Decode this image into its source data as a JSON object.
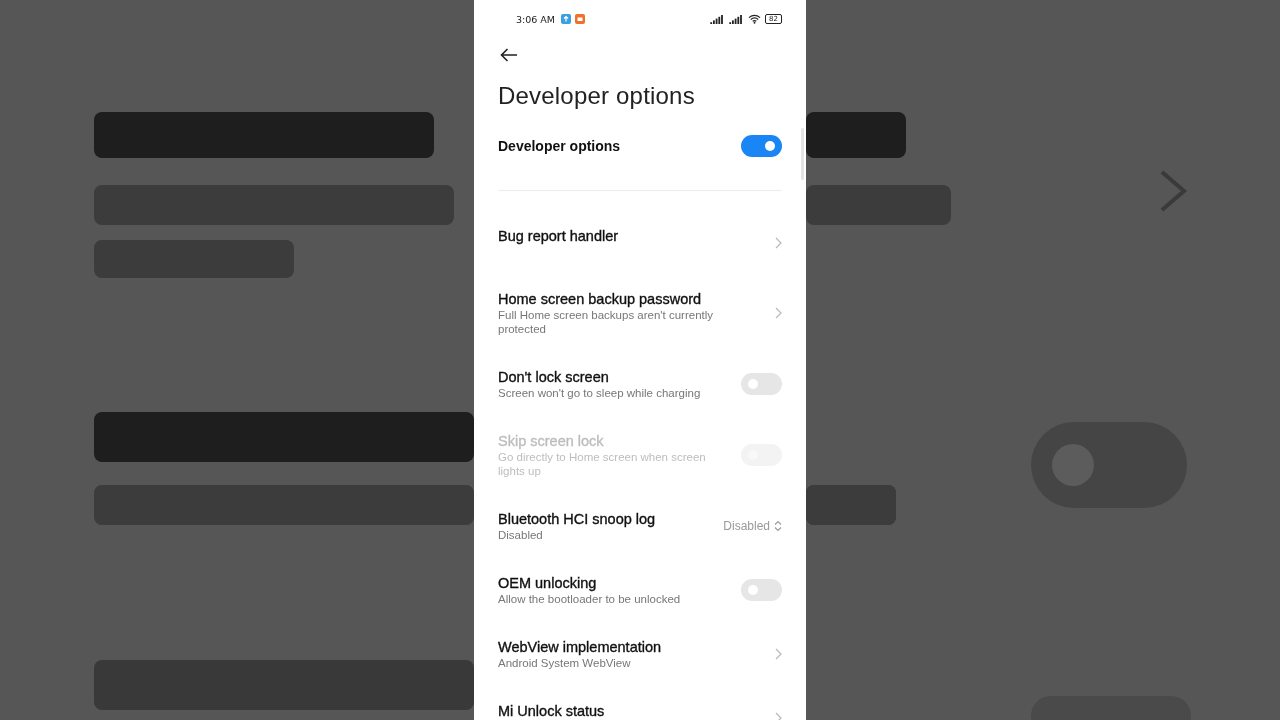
{
  "status_bar": {
    "time": "3:06 AM",
    "battery": "82"
  },
  "title": "Developer options",
  "master": {
    "label": "Developer options",
    "on": true
  },
  "items": [
    {
      "kind": "link",
      "title": "Bug report handler"
    },
    {
      "kind": "link",
      "title": "Home screen backup password",
      "subtitle": "Full Home screen backups aren't currently protected"
    },
    {
      "kind": "toggle",
      "title": "Don't lock screen",
      "subtitle": "Screen won't go to sleep while charging",
      "on": false,
      "disabled": false
    },
    {
      "kind": "toggle",
      "title": "Skip screen lock",
      "subtitle": "Go directly to Home screen when screen lights up",
      "on": false,
      "disabled": true
    },
    {
      "kind": "select",
      "title": "Bluetooth HCI snoop log",
      "subtitle": "Disabled",
      "value": "Disabled"
    },
    {
      "kind": "toggle",
      "title": "OEM unlocking",
      "subtitle": "Allow the bootloader to be unlocked",
      "on": false,
      "disabled": false
    },
    {
      "kind": "link",
      "title": "WebView implementation",
      "subtitle": "Android System WebView"
    },
    {
      "kind": "link",
      "title": "Mi Unlock status"
    }
  ]
}
